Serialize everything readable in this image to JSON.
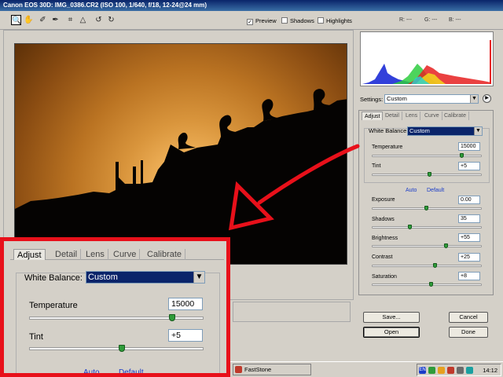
{
  "window": {
    "title": "Canon EOS 30D: IMG_0386.CR2  (ISO 100, 1/640, f/18, 12-24@24 mm)"
  },
  "toolbar": {
    "tools": [
      "zoom-icon",
      "hand-icon",
      "eyedropper-icon",
      "color-sampler-icon",
      "crop-icon",
      "straighten-icon",
      "rotate-left-icon",
      "rotate-right-icon"
    ],
    "preview": {
      "label": "Preview",
      "checked": true
    },
    "shadows": {
      "label": "Shadows",
      "checked": false
    },
    "highlights": {
      "label": "Highlights",
      "checked": false
    },
    "r": "R:  ---",
    "g": "G:  ---",
    "b": "B:  ---"
  },
  "settings": {
    "label": "Settings:",
    "value": "Custom"
  },
  "tabs": [
    "Adjust",
    "Detail",
    "Lens",
    "Curve",
    "Calibrate"
  ],
  "active_tab": "Adjust",
  "white_balance": {
    "label": "White Balance:",
    "value": "Custom"
  },
  "sliders": {
    "temperature": {
      "label": "Temperature",
      "value": "15000",
      "position": 0.82
    },
    "tint": {
      "label": "Tint",
      "value": "+5",
      "position": 0.53
    },
    "exposure": {
      "label": "Exposure",
      "value": "0.00",
      "position": 0.5
    },
    "shadows": {
      "label": "Shadows",
      "value": "35",
      "position": 0.35
    },
    "brightness": {
      "label": "Brightness",
      "value": "+55",
      "position": 0.68
    },
    "contrast": {
      "label": "Contrast",
      "value": "+25",
      "position": 0.58
    },
    "saturation": {
      "label": "Saturation",
      "value": "+8",
      "position": 0.54
    }
  },
  "links": {
    "auto": "Auto",
    "default": "Default"
  },
  "buttons": {
    "save": "Save...",
    "cancel": "Cancel",
    "open": "Open",
    "done": "Done"
  },
  "taskbar": {
    "task": "FastStone",
    "tray_lang": "EN",
    "clock": "14:12"
  },
  "colors": {
    "annotation": "#e8101a",
    "selection": "#0a246a",
    "link": "#1a3cc8",
    "slider_thumb": "#2f9c3a"
  }
}
